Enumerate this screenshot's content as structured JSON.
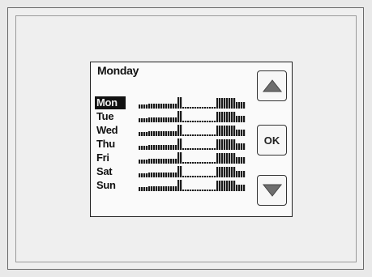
{
  "screen": {
    "title": "Monday"
  },
  "days": [
    {
      "label": "Mon",
      "selected": true
    },
    {
      "label": "Tue",
      "selected": false
    },
    {
      "label": "Wed",
      "selected": false
    },
    {
      "label": "Thu",
      "selected": false
    },
    {
      "label": "Fri",
      "selected": false
    },
    {
      "label": "Sat",
      "selected": false
    },
    {
      "label": "Sun",
      "selected": false
    }
  ],
  "buttons": {
    "up_icon": "up-triangle-icon",
    "ok_label": "OK",
    "down_icon": "down-triangle-icon"
  }
}
